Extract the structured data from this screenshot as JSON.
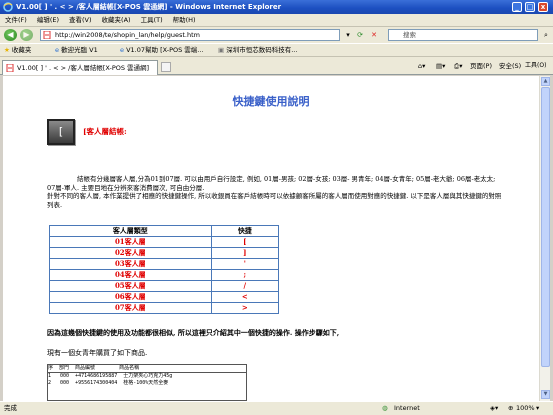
{
  "window": {
    "title": "V1.00[ ] ' . < > /客人層結帳[X-POS 雲通網] - Windows Internet Explorer",
    "minimize": "_",
    "maximize": "□",
    "close": "x"
  },
  "menu": [
    "文件(F)",
    "编辑(E)",
    "查看(V)",
    "收藏夹(A)",
    "工具(T)",
    "帮助(H)"
  ],
  "address": {
    "url": "http://win2008/te/shopin_lan/help/guest.htm",
    "search_placeholder": "搜索"
  },
  "favorites": {
    "label": "收藏夹",
    "items": [
      "歡迎光臨 V1",
      "V1.07幫助 [X-POS 雲端...",
      "深圳市恒芯数码科技有..."
    ]
  },
  "tabs": [
    {
      "label": "V1.00[ ] ' . < > /客人層結帳[X-POS 雲通網]"
    }
  ],
  "toolbar_right": [
    "页面(P)",
    "安全(S)",
    "工具(O)"
  ],
  "page": {
    "title": "快捷鍵使用說明",
    "key_icon": "[",
    "section_title": "[客人層結帳:",
    "paragraph1": "結帳有分幾層客人層,分為01到07層. 可以由用戶自行設定, 例如, 01層-男孩; 02層-女孩; 03層- 男青年; 04層-女青年; 05層-老大爺; 06層-老太太; 07層-軍人. 主要目地在分辨來客消費層次, 可自由分層.",
    "paragraph2": "針對不同的客人層, 本作業提供了相應的快捷鍵操作, 所以收銀員在客戶結帳時可以依據顧客所屬的客人層而使用對應的快捷鍵. 以下是客人層與其快捷鍵的對照列表.",
    "table": {
      "headers": [
        "客人層類型",
        "快捷"
      ],
      "rows": [
        [
          "01客人層",
          "["
        ],
        [
          "02客人層",
          "]"
        ],
        [
          "03客人層",
          "'"
        ],
        [
          "04客人層",
          ";"
        ],
        [
          "05客人層",
          "/"
        ],
        [
          "06客人層",
          "<"
        ],
        [
          "07客人層",
          ">"
        ]
      ]
    },
    "note": "因為這幾個快捷鍵的使用及功能都很相似, 所以這裡只介紹其中一個快捷的操作. 操作步驟如下,",
    "note2": "現有一個女青年購買了如下商品.",
    "receipt": {
      "header": "序  部門  商品編號        商品名稱",
      "lines": [
        "1   000  +4714686195887  士力架夾心巧克力45g",
        "2   000  +9556174300404  桂格-100%天然全麥"
      ]
    }
  },
  "status": {
    "text": "完成",
    "zone": "Internet",
    "zoom": "100%"
  }
}
